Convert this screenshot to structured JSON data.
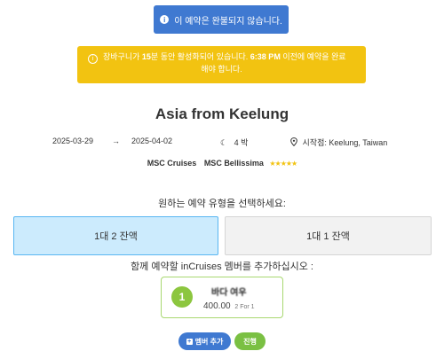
{
  "alerts": {
    "status": "이 예약은 완불되지 않습니다.",
    "cart_before": "장바구니가 ",
    "cart_minutes": "15",
    "cart_mid": "분 동안 활성화되어 있습니다. ",
    "cart_time": "6:38 PM",
    "cart_after": " 이전에 예약을 완료",
    "cart_line2": "해야 합니다."
  },
  "trip": {
    "title": "Asia from Keelung",
    "start_date": "2025-03-29",
    "arrow": "→",
    "end_date": "2025-04-02",
    "nights": "4 박",
    "departure_label": "시작점: Keelung, Taiwan",
    "cruise_line": "MSC Cruises",
    "ship": "MSC Bellissima",
    "stars": "★★★★★"
  },
  "booking": {
    "select_heading": "원하는 예약 유형을 선택하세요:",
    "options": [
      "1대 2 잔액",
      "1대 1 잔액"
    ],
    "member_heading": "함께 예약할 inCruises 멤버를 추가하십시오 :"
  },
  "member": {
    "number": "1",
    "name": "바다 여우",
    "price": "400.00",
    "price_note": "2 For 1"
  },
  "buttons": {
    "add_member": "멤버 추가",
    "proceed": "진행"
  }
}
